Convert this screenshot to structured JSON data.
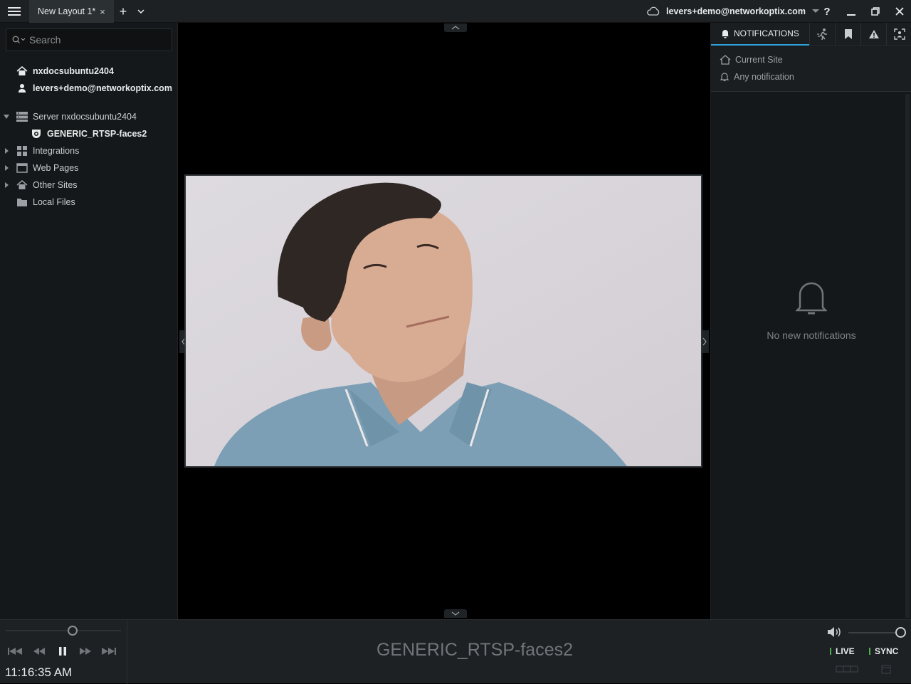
{
  "titlebar": {
    "tab_label": "New Layout 1*",
    "tab_close": "×",
    "add_tab": "+",
    "account": "levers+demo@networkoptix.com",
    "help": "?"
  },
  "left_panel": {
    "search_placeholder": "Search",
    "items": [
      {
        "label": "nxdocsubuntu2404"
      },
      {
        "label": "levers+demo@networkoptix.com"
      },
      {
        "label": "Server nxdocsubuntu2404"
      },
      {
        "label": "GENERIC_RTSP-faces2"
      },
      {
        "label": "Integrations"
      },
      {
        "label": "Web Pages"
      },
      {
        "label": "Other Sites"
      },
      {
        "label": "Local Files"
      }
    ]
  },
  "scene": {
    "camera_name": "GENERIC_RTSP-faces2"
  },
  "right_panel": {
    "tab_notifications": "NOTIFICATIONS",
    "filter_site": "Current Site",
    "filter_type": "Any notification",
    "empty_text": "No new notifications"
  },
  "bottom_bar": {
    "time": "11:16:35 AM",
    "camera_title": "GENERIC_RTSP-faces2",
    "live_label": "LIVE",
    "sync_label": "SYNC",
    "live_indicator_color": "#4caf50"
  }
}
